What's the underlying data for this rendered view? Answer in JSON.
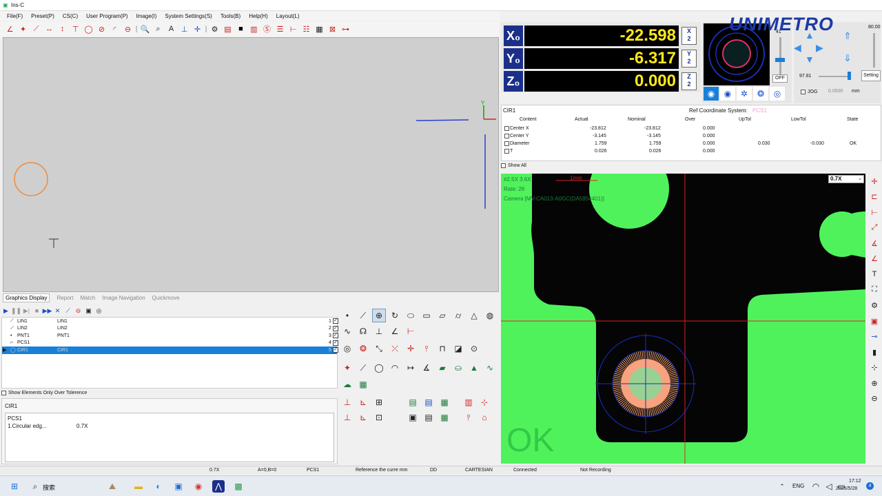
{
  "app": {
    "title": "Ins-C",
    "brand": "UNIMETRO"
  },
  "menu": [
    "File(F)",
    "Preset(P)",
    "CS(C)",
    "User Program(P)",
    "Image(I)",
    "System Settings(S)",
    "Tools(B)",
    "Help(H)",
    "Layout(L)"
  ],
  "dro": {
    "x_label": "X₀",
    "x_value": "-22.598",
    "y_label": "Y₀",
    "y_value": "-6.317",
    "z_label": "Z₀",
    "z_value": "0.000",
    "half_label": "X/2"
  },
  "light": {
    "top_value": "41",
    "off_label": "OFF"
  },
  "motion": {
    "speed": "80.00",
    "position": "97.81",
    "setting": "Setting",
    "jog_label": "JOG",
    "step": "0.0500",
    "unit": "mm"
  },
  "result": {
    "element": "CIR1",
    "ref_label": "Ref Coordinate System:",
    "ref_value": "PCS1",
    "headers": [
      "Content",
      "Actual",
      "Nominal",
      "Over",
      "UpTol",
      "LowTol",
      "State"
    ],
    "rows": [
      {
        "content": "Center X",
        "actual": "-23.812",
        "nominal": "-23.812",
        "over": "0.000",
        "uptol": "",
        "lowtol": "",
        "state": ""
      },
      {
        "content": "Center Y",
        "actual": "-3.145",
        "nominal": "-3.145",
        "over": "0.000",
        "uptol": "",
        "lowtol": "",
        "state": ""
      },
      {
        "content": "Diameter",
        "actual": "1.759",
        "nominal": "1.759",
        "over": "0.000",
        "uptol": "0.030",
        "lowtol": "-0.030",
        "state": "OK"
      },
      {
        "content": "T",
        "actual": "0.026",
        "nominal": "0.026",
        "over": "0.000",
        "uptol": "",
        "lowtol": "",
        "state": ""
      }
    ],
    "show_all": "Show All"
  },
  "camera": {
    "mag_line": "#2.5X  3.6X",
    "scale": "1mm",
    "rate": "Rate: 26",
    "cam_name": "Camera [MV-CA013-A0GC(DA5954401)]",
    "zoom": "0.7X",
    "verdict": "OK"
  },
  "tabs": [
    "Graphics Display",
    "Report",
    "Match",
    "Image Navigation",
    "Quickmove"
  ],
  "elements": [
    {
      "icon": "⟋",
      "name": "LIN1",
      "name2": "LIN1",
      "idx": "1",
      "checked": "✓"
    },
    {
      "icon": "⟋",
      "name": "LIN2",
      "name2": "LIN2",
      "idx": "2",
      "checked": "✓"
    },
    {
      "icon": "•",
      "name": "PNT1",
      "name2": "PNT1",
      "idx": "3",
      "checked": "✓"
    },
    {
      "icon": "⌐",
      "name": "PCS1",
      "name2": "",
      "idx": "4",
      "checked": "✓"
    },
    {
      "icon": "◯",
      "name": "CIR1",
      "name2": "CIR1",
      "idx": "5",
      "checked": "✓"
    }
  ],
  "show_over": "Show Elements Only Over Tolerence",
  "info": {
    "title": "CIR1",
    "line1": "PCS1",
    "line2_a": "1.Circular edg...",
    "line2_b": "0.7X"
  },
  "status": {
    "zoom": "0.7X",
    "ab": "A=0,B=0",
    "pcs": "PCS1",
    "ref": "Reference the curre  mm",
    "dd": "DD",
    "mode": "CARTESIAN",
    "conn": "Connected",
    "rec": "Not Recording"
  },
  "taskbar": {
    "search": "搜索",
    "lang": "ENG",
    "time": "17:12",
    "date": "2025/5/28",
    "badge": "4"
  },
  "colors": {
    "dro_label": "#1b2f8a",
    "dro_value": "#ffe81a",
    "camera_bg": "#50f25c",
    "selection": "#1a7fd6"
  }
}
